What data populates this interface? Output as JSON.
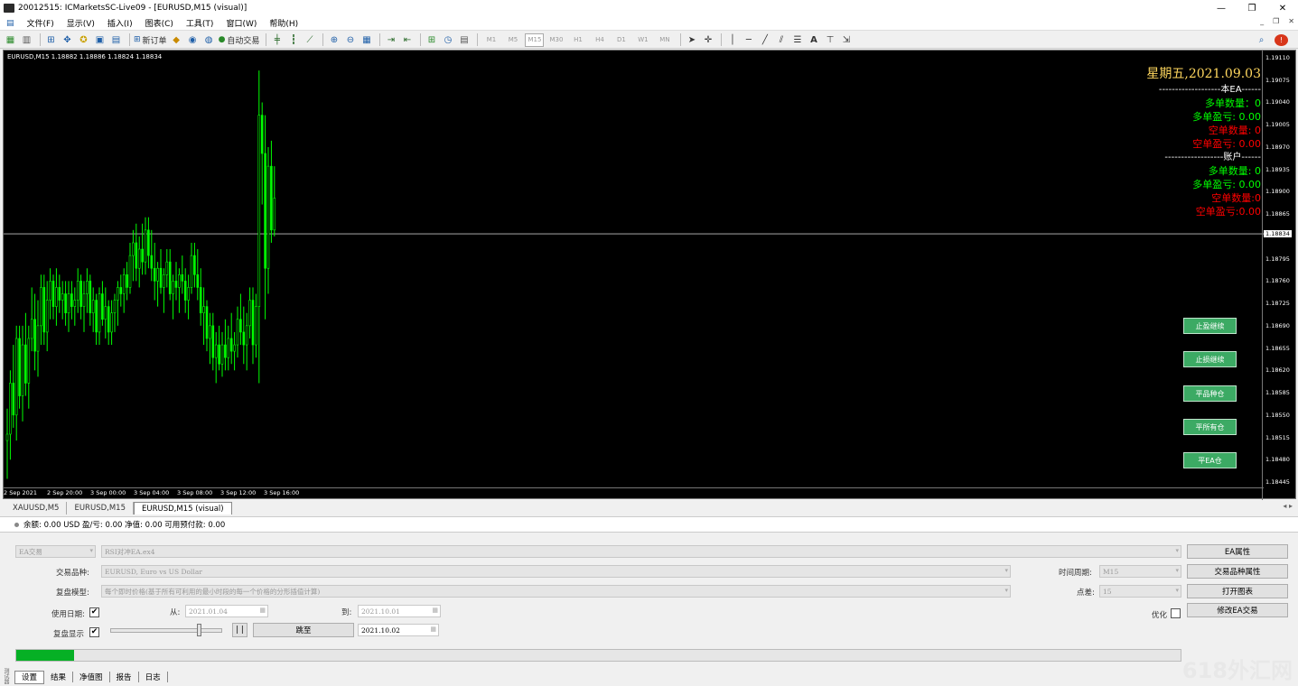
{
  "window": {
    "title": "20012515: ICMarketsSC-Live09 - [EURUSD,M15 (visual)]",
    "controls": [
      "—",
      "❐",
      "✕"
    ],
    "mdi_controls": [
      "_",
      "❐",
      "✕"
    ]
  },
  "menu": [
    "文件(F)",
    "显示(V)",
    "插入(I)",
    "图表(C)",
    "工具(T)",
    "窗口(W)",
    "帮助(H)"
  ],
  "toolbar": {
    "new_order": "新订单",
    "auto_trading": "自动交易",
    "timeframes": [
      "M1",
      "M5",
      "M15",
      "M30",
      "H1",
      "H4",
      "D1",
      "W1",
      "MN"
    ]
  },
  "chart": {
    "symbol_line": "EURUSD,M15  1.18882 1.18886 1.18824 1.18834",
    "price_ticks": [
      "1.19110",
      "1.19075",
      "1.19040",
      "1.19005",
      "1.18970",
      "1.18935",
      "1.18900",
      "1.18865",
      "1.18834",
      "1.18795",
      "1.18760",
      "1.18725",
      "1.18690",
      "1.18655",
      "1.18620",
      "1.18585",
      "1.18550",
      "1.18515",
      "1.18480",
      "1.18445"
    ],
    "time_ticks": [
      "2 Sep 2021",
      "2 Sep 20:00",
      "3 Sep 00:00",
      "3 Sep 04:00",
      "3 Sep 08:00",
      "3 Sep 12:00",
      "3 Sep 16:00"
    ],
    "colors": {
      "bull": "#00ff00",
      "bear": "#00ff00",
      "bg": "#000000",
      "level": "#c0c0c0"
    }
  },
  "chart_data": {
    "type": "candlestick",
    "title": "EURUSD,M15",
    "current_price": 1.18834,
    "ylim": [
      1.18445,
      1.1911
    ],
    "ohlc": [
      [
        1.1851,
        1.1856,
        1.1845,
        1.1852
      ],
      [
        1.1852,
        1.1862,
        1.1848,
        1.186
      ],
      [
        1.186,
        1.1866,
        1.1853,
        1.1855
      ],
      [
        1.1855,
        1.1869,
        1.1851,
        1.1867
      ],
      [
        1.1867,
        1.1869,
        1.1856,
        1.1858
      ],
      [
        1.1858,
        1.1869,
        1.1854,
        1.1866
      ],
      [
        1.1866,
        1.1871,
        1.1858,
        1.186
      ],
      [
        1.186,
        1.1869,
        1.1856,
        1.1867
      ],
      [
        1.1867,
        1.1875,
        1.1865,
        1.187
      ],
      [
        1.187,
        1.1874,
        1.1862,
        1.1865
      ],
      [
        1.1865,
        1.1873,
        1.1861,
        1.1869
      ],
      [
        1.1869,
        1.1877,
        1.1866,
        1.1875
      ],
      [
        1.1875,
        1.1877,
        1.1866,
        1.1868
      ],
      [
        1.1868,
        1.1876,
        1.1865,
        1.1873
      ],
      [
        1.1873,
        1.1878,
        1.187,
        1.1876
      ],
      [
        1.1876,
        1.1877,
        1.187,
        1.1872
      ],
      [
        1.1872,
        1.1878,
        1.1869,
        1.1875
      ],
      [
        1.1875,
        1.1877,
        1.1871,
        1.1873
      ],
      [
        1.1873,
        1.1876,
        1.187,
        1.1874
      ],
      [
        1.1874,
        1.1876,
        1.1869,
        1.1871
      ],
      [
        1.1871,
        1.1876,
        1.1868,
        1.1874
      ],
      [
        1.1874,
        1.1876,
        1.187,
        1.1872
      ],
      [
        1.1872,
        1.1875,
        1.1869,
        1.1873
      ],
      [
        1.1873,
        1.1878,
        1.1871,
        1.1876
      ],
      [
        1.1876,
        1.1877,
        1.187,
        1.1872
      ],
      [
        1.1872,
        1.1876,
        1.1868,
        1.1874
      ],
      [
        1.1874,
        1.1878,
        1.1871,
        1.1876
      ],
      [
        1.1876,
        1.1877,
        1.1869,
        1.1871
      ],
      [
        1.1871,
        1.1875,
        1.1868,
        1.1873
      ],
      [
        1.1873,
        1.1874,
        1.1866,
        1.1868
      ],
      [
        1.1868,
        1.1875,
        1.1866,
        1.1874
      ],
      [
        1.1874,
        1.1876,
        1.1869,
        1.187
      ],
      [
        1.187,
        1.1875,
        1.1867,
        1.1872
      ],
      [
        1.1872,
        1.1873,
        1.1866,
        1.1868
      ],
      [
        1.1868,
        1.1873,
        1.1866,
        1.1871
      ],
      [
        1.1871,
        1.1874,
        1.1868,
        1.1873
      ],
      [
        1.1873,
        1.1876,
        1.1869,
        1.1875
      ],
      [
        1.1875,
        1.1877,
        1.1872,
        1.1874
      ],
      [
        1.1874,
        1.1878,
        1.1871,
        1.1877
      ],
      [
        1.1877,
        1.1879,
        1.1873,
        1.1875
      ],
      [
        1.1875,
        1.1882,
        1.1874,
        1.188
      ],
      [
        1.188,
        1.1884,
        1.1876,
        1.1882
      ],
      [
        1.1882,
        1.1885,
        1.1876,
        1.1878
      ],
      [
        1.1878,
        1.1883,
        1.1875,
        1.1881
      ],
      [
        1.1881,
        1.1885,
        1.1877,
        1.1879
      ],
      [
        1.1879,
        1.1886,
        1.1877,
        1.1884
      ],
      [
        1.1884,
        1.1886,
        1.1878,
        1.188
      ],
      [
        1.188,
        1.1884,
        1.1876,
        1.1878
      ],
      [
        1.1878,
        1.1882,
        1.1873,
        1.1876
      ],
      [
        1.1876,
        1.1879,
        1.1872,
        1.1878
      ],
      [
        1.1878,
        1.1881,
        1.1874,
        1.1875
      ],
      [
        1.1875,
        1.1878,
        1.1871,
        1.1877
      ],
      [
        1.1877,
        1.1881,
        1.1875,
        1.1879
      ],
      [
        1.1879,
        1.1881,
        1.1873,
        1.1874
      ],
      [
        1.1874,
        1.1877,
        1.187,
        1.1876
      ],
      [
        1.1876,
        1.1879,
        1.1873,
        1.1875
      ],
      [
        1.1875,
        1.1878,
        1.1871,
        1.1877
      ],
      [
        1.1877,
        1.188,
        1.1874,
        1.1876
      ],
      [
        1.1876,
        1.1878,
        1.1871,
        1.1873
      ],
      [
        1.1873,
        1.1877,
        1.187,
        1.1875
      ],
      [
        1.1875,
        1.1882,
        1.1874,
        1.188
      ],
      [
        1.188,
        1.1882,
        1.1875,
        1.1877
      ],
      [
        1.1877,
        1.1881,
        1.1873,
        1.1875
      ],
      [
        1.1875,
        1.1878,
        1.1869,
        1.1871
      ],
      [
        1.1871,
        1.1875,
        1.1866,
        1.1872
      ],
      [
        1.1872,
        1.1873,
        1.1865,
        1.1867
      ],
      [
        1.1867,
        1.1871,
        1.1863,
        1.1869
      ],
      [
        1.1869,
        1.1871,
        1.1862,
        1.1864
      ],
      [
        1.1864,
        1.1868,
        1.186,
        1.1866
      ],
      [
        1.1866,
        1.1869,
        1.1862,
        1.1863
      ],
      [
        1.1863,
        1.1868,
        1.1861,
        1.1866
      ],
      [
        1.1866,
        1.187,
        1.1862,
        1.1864
      ],
      [
        1.1864,
        1.1869,
        1.1862,
        1.1867
      ],
      [
        1.1867,
        1.1871,
        1.1863,
        1.1865
      ],
      [
        1.1865,
        1.1868,
        1.1862,
        1.1866
      ],
      [
        1.1866,
        1.1872,
        1.1864,
        1.187
      ],
      [
        1.187,
        1.1874,
        1.1866,
        1.1868
      ],
      [
        1.1868,
        1.1872,
        1.1863,
        1.1866
      ],
      [
        1.1866,
        1.1871,
        1.1862,
        1.1869
      ],
      [
        1.1869,
        1.1875,
        1.1867,
        1.1873
      ],
      [
        1.1873,
        1.1875,
        1.1863,
        1.1866
      ],
      [
        1.1866,
        1.1874,
        1.1864,
        1.1872
      ],
      [
        1.1872,
        1.1909,
        1.186,
        1.1902
      ],
      [
        1.1902,
        1.1904,
        1.1888,
        1.1896
      ],
      [
        1.1896,
        1.1902,
        1.187,
        1.1878
      ],
      [
        1.1878,
        1.1897,
        1.1874,
        1.1894
      ],
      [
        1.1894,
        1.1898,
        1.1882,
        1.1884
      ],
      [
        1.1884,
        1.1894,
        1.1883,
        1.1889
      ]
    ]
  },
  "panel": {
    "date": "星期五,2021.09.03",
    "sep_ea": "-------------------本EA------",
    "ea_buy_count": "多单数量：0",
    "ea_buy_pl": "多单盈亏: 0.00",
    "ea_sell_count": "空单数量: 0",
    "ea_sell_pl": "空单盈亏: 0.00",
    "sep_acct": "------------------账户------",
    "acct_buy_count": "多单数量: 0",
    "acct_buy_pl": "多单盈亏: 0.00",
    "acct_sell_count": "空单数量:0",
    "acct_sell_pl": "空单盈亏:0.00"
  },
  "ea_buttons": [
    "止盈继续",
    "止损继续",
    "平品种仓",
    "平所有仓",
    "平EA仓"
  ],
  "chart_tabs": [
    "XAUUSD,M5",
    "EURUSD,M15",
    "EURUSD,M15 (visual)"
  ],
  "account": {
    "text": "余额: 0.00 USD  盈/亏: 0.00  净值: 0.00  可用预付款: 0.00"
  },
  "tester": {
    "type_select": "EA交易",
    "ea_file": "RSI对冲EA.ex4",
    "symbol_label": "交易品种:",
    "symbol_value": "EURUSD, Euro vs US Dollar",
    "model_label": "复盘模型:",
    "model_value": "每个即时价格(基于所有可利用的最小时段的每一个价格的分形插值计算)",
    "period_label": "时间周期:",
    "period_value": "M15",
    "spread_label": "点差:",
    "spread_value": "15",
    "use_date_label": "使用日期:",
    "from_label": "从:",
    "from_value": "2021.01.04",
    "to_label": "到:",
    "to_value": "2021.10.01",
    "visual_label": "复盘显示",
    "pause_label": "| |",
    "jump_label": "跳至",
    "jump_date": "2021.10.02",
    "optimize_label": "优化",
    "btn_ea_props": "EA属性",
    "btn_symbol_props": "交易品种属性",
    "btn_open_chart": "打开图表",
    "btn_modify_ea": "修改EA交易",
    "progress": 0.05,
    "check_mark": "✔",
    "dropdown": "▾"
  },
  "bottom_tabs": [
    "设置",
    "结果",
    "净值图",
    "报告",
    "日志"
  ],
  "side_label": "测试器",
  "watermark": "618外汇网"
}
